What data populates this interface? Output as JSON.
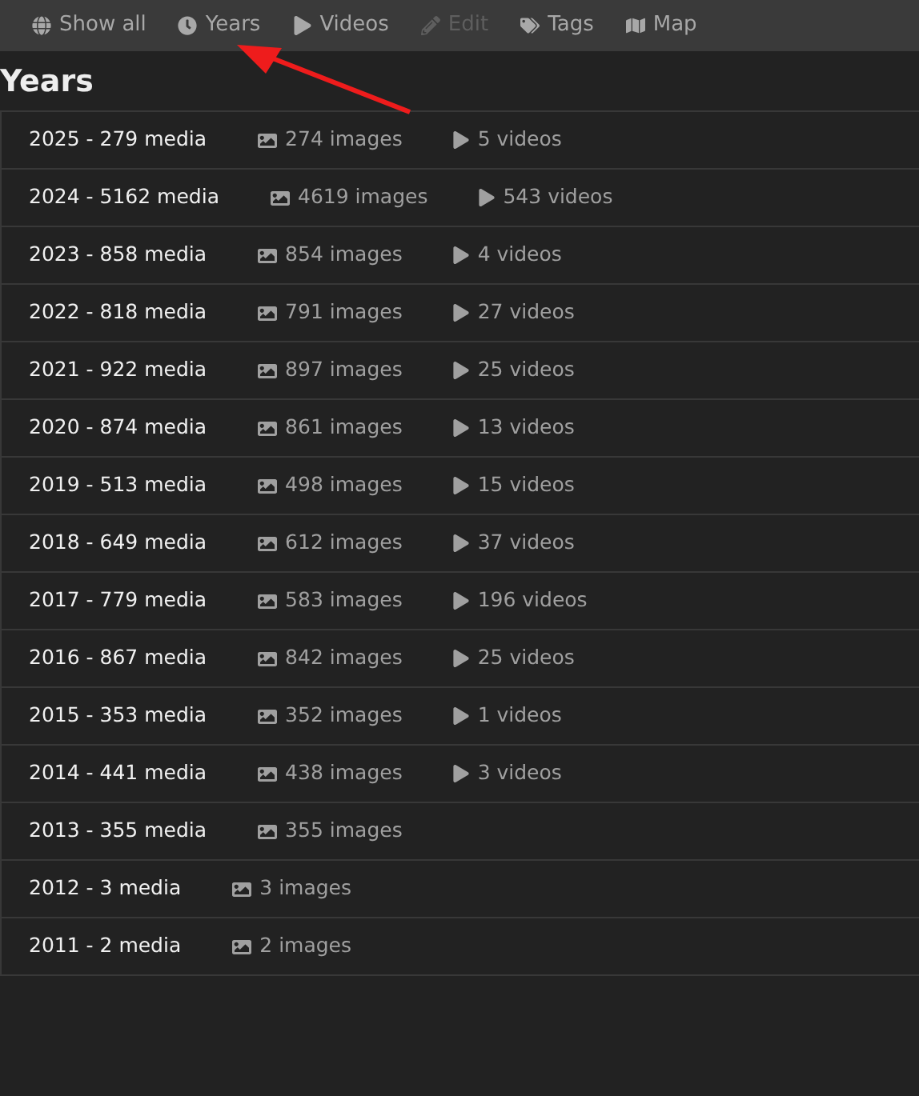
{
  "nav": [
    {
      "kind": "all",
      "label": "Show all",
      "disabled": false
    },
    {
      "kind": "years",
      "label": "Years",
      "disabled": false
    },
    {
      "kind": "videos",
      "label": "Videos",
      "disabled": false
    },
    {
      "kind": "edit",
      "label": "Edit",
      "disabled": true
    },
    {
      "kind": "tags",
      "label": "Tags",
      "disabled": false
    },
    {
      "kind": "map",
      "label": "Map",
      "disabled": false
    }
  ],
  "heading": "Years",
  "years": [
    {
      "title": "2025 - 279 media",
      "images": "274 images",
      "videos": "5 videos"
    },
    {
      "title": "2024 - 5162 media",
      "images": "4619 images",
      "videos": "543 videos"
    },
    {
      "title": "2023 - 858 media",
      "images": "854 images",
      "videos": "4 videos"
    },
    {
      "title": "2022 - 818 media",
      "images": "791 images",
      "videos": "27 videos"
    },
    {
      "title": "2021 - 922 media",
      "images": "897 images",
      "videos": "25 videos"
    },
    {
      "title": "2020 - 874 media",
      "images": "861 images",
      "videos": "13 videos"
    },
    {
      "title": "2019 - 513 media",
      "images": "498 images",
      "videos": "15 videos"
    },
    {
      "title": "2018 - 649 media",
      "images": "612 images",
      "videos": "37 videos"
    },
    {
      "title": "2017 - 779 media",
      "images": "583 images",
      "videos": "196 videos"
    },
    {
      "title": "2016 - 867 media",
      "images": "842 images",
      "videos": "25 videos"
    },
    {
      "title": "2015 - 353 media",
      "images": "352 images",
      "videos": "1 videos"
    },
    {
      "title": "2014 - 441 media",
      "images": "438 images",
      "videos": "3 videos"
    },
    {
      "title": "2013 - 355 media",
      "images": "355 images"
    },
    {
      "title": "2012 - 3 media",
      "images": "3 images"
    },
    {
      "title": "2011 - 2 media",
      "images": "2 images"
    }
  ]
}
